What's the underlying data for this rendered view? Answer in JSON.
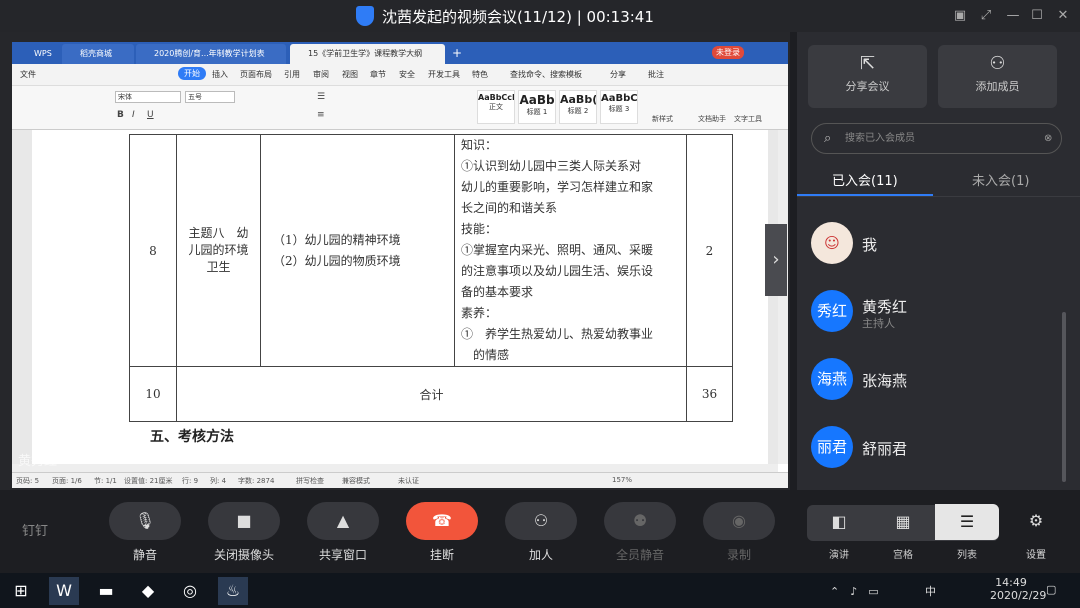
{
  "meeting": {
    "title": "沈茜发起的视频会议(11/12) | 00:13:41"
  },
  "wps": {
    "tabs": [
      "WPS",
      "稻壳商城",
      "2020腾创/育...年制教学计划表",
      "15《学前卫生学》课程教学大纲"
    ],
    "login": "未登录",
    "menus": [
      "文件",
      "开始",
      "插入",
      "页面布局",
      "引用",
      "审阅",
      "视图",
      "章节",
      "安全",
      "开发工具",
      "特色"
    ],
    "search": "查找命令、搜索模板",
    "share": "分享",
    "comment": "批注",
    "font": "宋体",
    "size": "五号",
    "styles": [
      {
        "sample": "AaBbCcDd",
        "name": "正文"
      },
      {
        "sample": "AaBb",
        "name": "标题 1"
      },
      {
        "sample": "AaBb(",
        "name": "标题 2"
      },
      {
        "sample": "AaBbC(",
        "name": "标题 3"
      }
    ],
    "tools": [
      "新样式",
      "文档助手",
      "文字工具"
    ]
  },
  "doc": {
    "row8": {
      "no": "8",
      "topic": [
        "主题八　幼",
        "儿园的环境",
        "卫生"
      ],
      "subs": [
        "（1）幼儿园的精神环境",
        "（2）幼儿园的物质环境"
      ],
      "goals": [
        "知识：",
        "①认识到幼儿园中三类人际关系对",
        "幼儿的重要影响，学习怎样建立和家",
        "长之间的和谐关系",
        "技能：",
        "①掌握室内采光、照明、通风、采暖",
        "的注意事项以及幼儿园生活、娱乐设",
        "备的基本要求",
        "素养：",
        "①　养学生热爱幼儿、热爱幼教事业",
        "　的情感"
      ],
      "hours": "2"
    },
    "row10": {
      "no": "10",
      "label": "合计",
      "hours": "36"
    },
    "heading": "五、考核方法"
  },
  "status": {
    "page": "页码: 5",
    "pages": "页面: 1/6",
    "sec": "节: 1/1",
    "pos": "设置值: 21厘米",
    "row": "行: 9",
    "col": "列: 4",
    "words": "字数: 2874",
    "spell": "拼写检查",
    "mode": "兼容模式",
    "cert": "未认证",
    "zoom": "157%"
  },
  "speaker": "黄秀红",
  "panel": {
    "share": "分享会议",
    "add": "添加成员",
    "search_placeholder": "搜索已入会成员",
    "tab_in": "已入会(11)",
    "tab_out": "未入会(1)",
    "members": [
      {
        "avatar": "",
        "name": "我",
        "role": ""
      },
      {
        "avatar": "秀红",
        "name": "黄秀红",
        "role": "主持人"
      },
      {
        "avatar": "海燕",
        "name": "张海燕",
        "role": ""
      },
      {
        "avatar": "丽君",
        "name": "舒丽君",
        "role": ""
      }
    ]
  },
  "controls": {
    "logo": "钉钉",
    "mute": "静音",
    "camera": "关闭摄像头",
    "share": "共享窗口",
    "hangup": "挂断",
    "join": "加人",
    "muteall": "全员静音",
    "record": "录制",
    "speech": "演讲",
    "grid": "宫格",
    "list": "列表",
    "settings": "设置"
  },
  "taskbar": {
    "time": "14:49",
    "date": "2020/2/29",
    "ime": "中"
  }
}
